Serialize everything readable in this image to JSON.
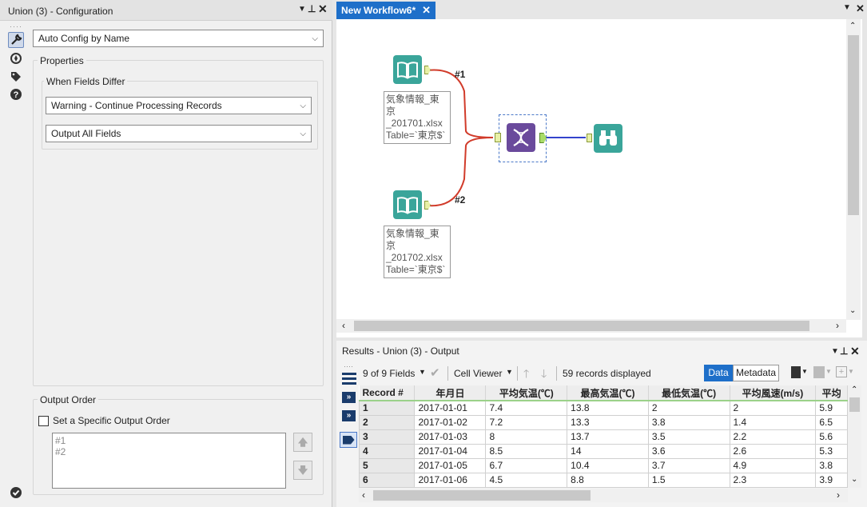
{
  "config_panel": {
    "title": "Union (3) - Configuration",
    "mode_select": "Auto Config by Name",
    "properties_label": "Properties",
    "when_fields_differ_label": "When Fields Differ",
    "differ_select": "Warning - Continue Processing Records",
    "output_select": "Output All Fields",
    "output_order_label": "Output Order",
    "set_order_label": "Set a Specific Output Order",
    "order_items": [
      "#1",
      "#2"
    ]
  },
  "workflow": {
    "tab_label": "New Workflow6*",
    "input1_connection": "#1",
    "input2_connection": "#2",
    "input1_annotation": [
      "気象情報_東京",
      "_201701.xlsx",
      "Table=`東京$`"
    ],
    "input2_annotation": [
      "気象情報_東京",
      "_201702.xlsx",
      "Table=`東京$`"
    ]
  },
  "results": {
    "title": "Results - Union (3) - Output",
    "fields_label": "9 of 9 Fields",
    "cell_viewer_label": "Cell Viewer",
    "records_label": "59 records displayed",
    "data_tab": "Data",
    "metadata_tab": "Metadata",
    "columns": [
      "Record #",
      "年月日",
      "平均気温(℃)",
      "最高気温(℃)",
      "最低気温(℃)",
      "平均風速(m/s)",
      "平均"
    ],
    "rows": [
      [
        "1",
        "2017-01-01",
        "7.4",
        "13.8",
        "2",
        "2",
        "5.9"
      ],
      [
        "2",
        "2017-01-02",
        "7.2",
        "13.3",
        "3.8",
        "1.4",
        "6.5"
      ],
      [
        "3",
        "2017-01-03",
        "8",
        "13.7",
        "3.5",
        "2.2",
        "5.6"
      ],
      [
        "4",
        "2017-01-04",
        "8.5",
        "14",
        "3.6",
        "2.6",
        "5.3"
      ],
      [
        "5",
        "2017-01-05",
        "6.7",
        "10.4",
        "3.7",
        "4.9",
        "3.8"
      ],
      [
        "6",
        "2017-01-06",
        "4.5",
        "8.8",
        "1.5",
        "2.3",
        "3.9"
      ]
    ]
  },
  "colors": {
    "tab_blue": "#1e6fc9",
    "input_teal": "#3aa59a",
    "union_purple": "#6a4a9c",
    "browse_teal": "#3aa59a",
    "connector_red": "#d13b2a",
    "connector_blue": "#3344cc",
    "header_green": "#9bd18a"
  }
}
